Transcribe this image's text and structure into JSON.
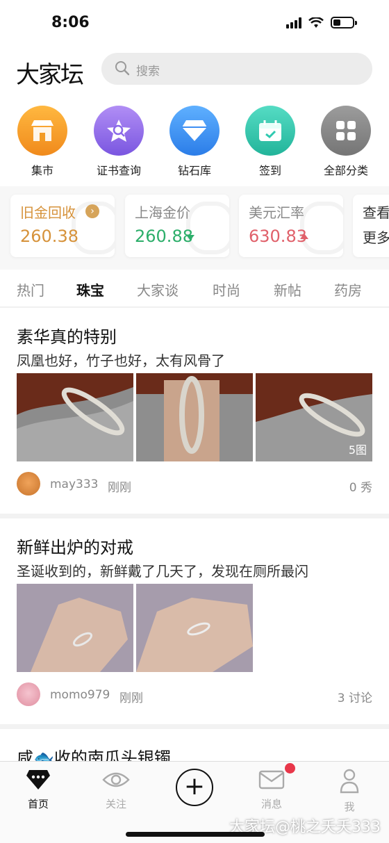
{
  "status": {
    "time": "8:06"
  },
  "header": {
    "logo": "大家坛",
    "search_placeholder": "搜索"
  },
  "quick": [
    {
      "label": "集市",
      "icon": "market-icon",
      "color": "#f5a623"
    },
    {
      "label": "证书查询",
      "icon": "certificate-search-icon",
      "color": "#8a68e8"
    },
    {
      "label": "钻石库",
      "icon": "diamond-icon",
      "color": "#3d8ef3"
    },
    {
      "label": "签到",
      "icon": "calendar-checkin-icon",
      "color": "#2fc9b0"
    },
    {
      "label": "全部分类",
      "icon": "grid-icon",
      "color": "#8a8a8a"
    }
  ],
  "tickers": [
    {
      "name": "旧金回收",
      "value": "260.38",
      "name_color": "#d6923a",
      "value_color": "#d6923a"
    },
    {
      "name": "上海金价",
      "value": "260.88",
      "name_color": "#888888",
      "value_color": "#2cae6a"
    },
    {
      "name": "美元汇率",
      "value": "630.83",
      "name_color": "#888888",
      "value_color": "#e0606a"
    },
    {
      "name": "查看",
      "value": "更多",
      "name_color": "#333333",
      "value_color": "#333333"
    }
  ],
  "tabs": [
    "热门",
    "珠宝",
    "大家谈",
    "时尚",
    "新帖",
    "药房"
  ],
  "posts": [
    {
      "title": "素华真的特别",
      "desc": "凤凰也好，竹子也好，太有风骨了",
      "image_count": "5图",
      "user": "may333",
      "time": "刚刚",
      "count": "0 秀"
    },
    {
      "title": "新鲜出炉的对戒",
      "desc": "圣诞收到的，新鲜戴了几天了，发现在厕所最闪",
      "user": "momo979",
      "time": "刚刚",
      "count": "3 讨论"
    },
    {
      "title": "咸🐟收的南瓜头银镯"
    }
  ],
  "nav": [
    {
      "label": "首页",
      "icon": "home-diamond-icon"
    },
    {
      "label": "关注",
      "icon": "eye-icon"
    },
    {
      "label": "消息",
      "icon": "mail-icon"
    },
    {
      "label": "我",
      "icon": "user-icon"
    }
  ],
  "watermark": "大家坛@桃之夭夭333"
}
